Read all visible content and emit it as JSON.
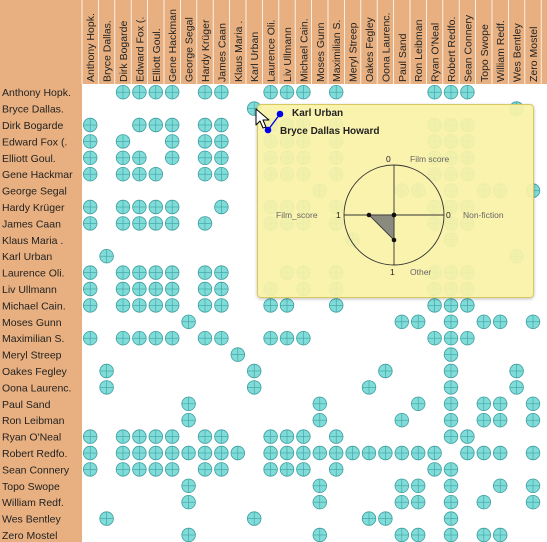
{
  "chart_data": {
    "type": "heatmap",
    "actors": [
      "Anthony Hopk.",
      "Bryce Dallas.",
      "Dirk Bogarde",
      "Edward Fox (.",
      "Elliott Goul.",
      "Gene Hackman",
      "George Segal",
      "Hardy Krüger",
      "James Caan",
      "Klaus Maria .",
      "Karl Urban",
      "Laurence Oli.",
      "Liv Ullmann",
      "Michael Cain.",
      "Moses Gunn",
      "Maximilian S.",
      "Meryl Streep",
      "Oakes Fegley",
      "Oona Laurenc.",
      "Paul Sand",
      "Ron Leibman",
      "Ryan O'Neal",
      "Robert Redfo.",
      "Sean Connery",
      "Topo Swope",
      "William Redf.",
      "Wes Bentley",
      "Zero Mostel"
    ],
    "row_labels": [
      "Anthony Hopk.",
      "Bryce Dallas.",
      "Dirk Bogarde",
      "Edward Fox (.",
      "Elliott Goul.",
      "Gene Hackmar",
      "George Segal",
      "Hardy Krüger",
      "James Caan",
      "Klaus Maria .",
      "Karl Urban",
      "Laurence Oli.",
      "Liv Ullmann",
      "Michael Cain.",
      "Moses Gunn",
      "Maximilian S.",
      "Meryl Streep",
      "Oakes Fegley",
      "Oona Laurenc.",
      "Paul Sand",
      "Ron Leibman",
      "Ryan O'Neal",
      "Robert Redfo.",
      "Sean Connery",
      "Topo Swope",
      "William Redf.",
      "Wes Bentley",
      "Zero Mostel"
    ],
    "col_labels": [
      "Anthony Hopk.",
      "Bryce Dallas.",
      "Dirk Bogarde",
      "Edward Fox (.",
      "Elliott Goul.",
      "Gene Hackman",
      "George Segal",
      "Hardy Krüger",
      "James Caan",
      "Klaus Maria .",
      "Karl Urban",
      "Laurence Oli.",
      "Liv Ullmann",
      "Michael Cain.",
      "Moses Gunn",
      "Maximilian S.",
      "Meryl Streep",
      "Oakes Fegley",
      "Oona Laurenc.",
      "Paul Sand",
      "Ron Leibman",
      "Ryan O'Neal",
      "Robert Redfo.",
      "Sean Connery",
      "Topo Swope",
      "William Redf.",
      "Wes Bentley",
      "Zero Mostel"
    ],
    "cells": [
      [
        0,
        2
      ],
      [
        0,
        3
      ],
      [
        0,
        4
      ],
      [
        0,
        5
      ],
      [
        0,
        7
      ],
      [
        0,
        8
      ],
      [
        0,
        11
      ],
      [
        0,
        12
      ],
      [
        0,
        13
      ],
      [
        0,
        15
      ],
      [
        0,
        21
      ],
      [
        0,
        22
      ],
      [
        0,
        23
      ],
      [
        1,
        10
      ],
      [
        1,
        26
      ],
      [
        2,
        0
      ],
      [
        2,
        3
      ],
      [
        2,
        4
      ],
      [
        2,
        5
      ],
      [
        2,
        7
      ],
      [
        2,
        8
      ],
      [
        2,
        11
      ],
      [
        2,
        12
      ],
      [
        2,
        13
      ],
      [
        2,
        15
      ],
      [
        2,
        21
      ],
      [
        2,
        22
      ],
      [
        2,
        23
      ],
      [
        3,
        0
      ],
      [
        3,
        2
      ],
      [
        3,
        5
      ],
      [
        3,
        7
      ],
      [
        3,
        8
      ],
      [
        3,
        11
      ],
      [
        3,
        12
      ],
      [
        3,
        13
      ],
      [
        3,
        15
      ],
      [
        3,
        21
      ],
      [
        3,
        22
      ],
      [
        3,
        23
      ],
      [
        4,
        0
      ],
      [
        4,
        2
      ],
      [
        4,
        3
      ],
      [
        4,
        5
      ],
      [
        4,
        7
      ],
      [
        4,
        8
      ],
      [
        4,
        11
      ],
      [
        4,
        12
      ],
      [
        4,
        13
      ],
      [
        4,
        15
      ],
      [
        4,
        21
      ],
      [
        4,
        22
      ],
      [
        4,
        23
      ],
      [
        5,
        0
      ],
      [
        5,
        2
      ],
      [
        5,
        3
      ],
      [
        5,
        4
      ],
      [
        5,
        7
      ],
      [
        5,
        8
      ],
      [
        5,
        11
      ],
      [
        5,
        12
      ],
      [
        5,
        13
      ],
      [
        5,
        15
      ],
      [
        5,
        21
      ],
      [
        5,
        22
      ],
      [
        5,
        23
      ],
      [
        6,
        14
      ],
      [
        6,
        19
      ],
      [
        6,
        20
      ],
      [
        6,
        22
      ],
      [
        6,
        24
      ],
      [
        6,
        25
      ],
      [
        6,
        27
      ],
      [
        7,
        0
      ],
      [
        7,
        2
      ],
      [
        7,
        3
      ],
      [
        7,
        4
      ],
      [
        7,
        5
      ],
      [
        7,
        8
      ],
      [
        7,
        11
      ],
      [
        7,
        12
      ],
      [
        7,
        13
      ],
      [
        7,
        15
      ],
      [
        7,
        21
      ],
      [
        7,
        22
      ],
      [
        7,
        23
      ],
      [
        8,
        0
      ],
      [
        8,
        2
      ],
      [
        8,
        3
      ],
      [
        8,
        4
      ],
      [
        8,
        5
      ],
      [
        8,
        7
      ],
      [
        8,
        11
      ],
      [
        8,
        12
      ],
      [
        8,
        13
      ],
      [
        8,
        15
      ],
      [
        8,
        21
      ],
      [
        8,
        22
      ],
      [
        8,
        23
      ],
      [
        9,
        16
      ],
      [
        9,
        22
      ],
      [
        10,
        1
      ],
      [
        10,
        26
      ],
      [
        11,
        0
      ],
      [
        11,
        2
      ],
      [
        11,
        3
      ],
      [
        11,
        4
      ],
      [
        11,
        5
      ],
      [
        11,
        7
      ],
      [
        11,
        8
      ],
      [
        11,
        12
      ],
      [
        11,
        13
      ],
      [
        11,
        15
      ],
      [
        11,
        21
      ],
      [
        11,
        22
      ],
      [
        11,
        23
      ],
      [
        12,
        0
      ],
      [
        12,
        2
      ],
      [
        12,
        3
      ],
      [
        12,
        4
      ],
      [
        12,
        5
      ],
      [
        12,
        7
      ],
      [
        12,
        8
      ],
      [
        12,
        11
      ],
      [
        12,
        13
      ],
      [
        12,
        15
      ],
      [
        12,
        21
      ],
      [
        12,
        22
      ],
      [
        12,
        23
      ],
      [
        13,
        0
      ],
      [
        13,
        2
      ],
      [
        13,
        3
      ],
      [
        13,
        4
      ],
      [
        13,
        5
      ],
      [
        13,
        7
      ],
      [
        13,
        8
      ],
      [
        13,
        11
      ],
      [
        13,
        12
      ],
      [
        13,
        15
      ],
      [
        13,
        21
      ],
      [
        13,
        22
      ],
      [
        13,
        23
      ],
      [
        14,
        6
      ],
      [
        14,
        19
      ],
      [
        14,
        20
      ],
      [
        14,
        22
      ],
      [
        14,
        24
      ],
      [
        14,
        25
      ],
      [
        14,
        27
      ],
      [
        15,
        0
      ],
      [
        15,
        2
      ],
      [
        15,
        3
      ],
      [
        15,
        4
      ],
      [
        15,
        5
      ],
      [
        15,
        7
      ],
      [
        15,
        8
      ],
      [
        15,
        11
      ],
      [
        15,
        12
      ],
      [
        15,
        13
      ],
      [
        15,
        21
      ],
      [
        15,
        22
      ],
      [
        15,
        23
      ],
      [
        16,
        9
      ],
      [
        16,
        22
      ],
      [
        17,
        1
      ],
      [
        17,
        10
      ],
      [
        17,
        18
      ],
      [
        17,
        22
      ],
      [
        17,
        26
      ],
      [
        18,
        1
      ],
      [
        18,
        10
      ],
      [
        18,
        17
      ],
      [
        18,
        22
      ],
      [
        18,
        26
      ],
      [
        19,
        6
      ],
      [
        19,
        14
      ],
      [
        19,
        20
      ],
      [
        19,
        22
      ],
      [
        19,
        24
      ],
      [
        19,
        25
      ],
      [
        19,
        27
      ],
      [
        20,
        6
      ],
      [
        20,
        14
      ],
      [
        20,
        19
      ],
      [
        20,
        22
      ],
      [
        20,
        24
      ],
      [
        20,
        25
      ],
      [
        20,
        27
      ],
      [
        21,
        0
      ],
      [
        21,
        2
      ],
      [
        21,
        3
      ],
      [
        21,
        4
      ],
      [
        21,
        5
      ],
      [
        21,
        7
      ],
      [
        21,
        8
      ],
      [
        21,
        11
      ],
      [
        21,
        12
      ],
      [
        21,
        13
      ],
      [
        21,
        15
      ],
      [
        21,
        22
      ],
      [
        21,
        23
      ],
      [
        22,
        0
      ],
      [
        22,
        2
      ],
      [
        22,
        3
      ],
      [
        22,
        4
      ],
      [
        22,
        5
      ],
      [
        22,
        6
      ],
      [
        22,
        7
      ],
      [
        22,
        8
      ],
      [
        22,
        9
      ],
      [
        22,
        11
      ],
      [
        22,
        12
      ],
      [
        22,
        13
      ],
      [
        22,
        14
      ],
      [
        22,
        15
      ],
      [
        22,
        16
      ],
      [
        22,
        17
      ],
      [
        22,
        18
      ],
      [
        22,
        19
      ],
      [
        22,
        20
      ],
      [
        22,
        21
      ],
      [
        22,
        23
      ],
      [
        22,
        24
      ],
      [
        22,
        25
      ],
      [
        22,
        27
      ],
      [
        23,
        0
      ],
      [
        23,
        2
      ],
      [
        23,
        3
      ],
      [
        23,
        4
      ],
      [
        23,
        5
      ],
      [
        23,
        7
      ],
      [
        23,
        8
      ],
      [
        23,
        11
      ],
      [
        23,
        12
      ],
      [
        23,
        13
      ],
      [
        23,
        15
      ],
      [
        23,
        21
      ],
      [
        23,
        22
      ],
      [
        24,
        6
      ],
      [
        24,
        14
      ],
      [
        24,
        19
      ],
      [
        24,
        20
      ],
      [
        24,
        22
      ],
      [
        24,
        25
      ],
      [
        24,
        27
      ],
      [
        25,
        6
      ],
      [
        25,
        14
      ],
      [
        25,
        19
      ],
      [
        25,
        20
      ],
      [
        25,
        22
      ],
      [
        25,
        24
      ],
      [
        25,
        27
      ],
      [
        26,
        1
      ],
      [
        26,
        10
      ],
      [
        26,
        17
      ],
      [
        26,
        18
      ],
      [
        26,
        22
      ],
      [
        27,
        6
      ],
      [
        27,
        14
      ],
      [
        27,
        19
      ],
      [
        27,
        20
      ],
      [
        27,
        22
      ],
      [
        27,
        24
      ],
      [
        27,
        25
      ]
    ],
    "tooltip": {
      "actor_1": "Karl Urban",
      "actor_2": "Bryce Dallas Howard",
      "radar": {
        "axes": [
          "Film score",
          "Non-fiction",
          "Other",
          "Film_score"
        ],
        "values": [
          0,
          0,
          1,
          1
        ],
        "axis_values": [
          "0",
          "0",
          "1",
          "1"
        ]
      }
    }
  },
  "colors": {
    "header_bg": "#e8b080",
    "header_text": "#222222",
    "cell_fill": "#80dcd8",
    "cell_stroke": "#3f9ea0",
    "tooltip_bg": "#faf2a8",
    "radar_fill": "#777777",
    "link_line": "#0000ee"
  }
}
